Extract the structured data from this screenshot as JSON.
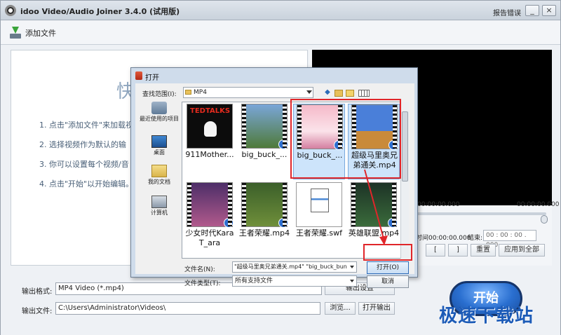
{
  "window": {
    "title": "idoo Video/Audio Joiner 3.4.0 (试用版)",
    "report_link": "报告错误",
    "minimize_glyph": "_",
    "close_glyph": "×"
  },
  "toolbar": {
    "add_label": "添加文件"
  },
  "hint": {
    "big_char": "快",
    "lines": [
      "1. 点击\"添加文件\"来加载视",
      "2. 选择视频作为默认的输",
      "3. 你可以设置每个视频/音",
      "4. 点击\"开始\"以开始编辑。"
    ]
  },
  "preview": {
    "time_left": "00:00:00.000",
    "time_right": "00:00:00.000",
    "start_time_label": "时间00:00:00.000",
    "end_label": "结束:",
    "end_time": "00 : 00 : 00 . 000",
    "mark_in": "[",
    "mark_out": "]",
    "reset": "重置",
    "apply_all": "应用到全部"
  },
  "bottom": {
    "format_label": "输出格式:",
    "format_value": "MP4 Video (*.mp4)",
    "settings_label": "输出设置",
    "file_label": "输出文件:",
    "path_value": "C:\\Users\\Administrator\\Videos\\",
    "browse": "浏览...",
    "open_output": "打开输出",
    "start": "开始"
  },
  "watermark": "极速下载站",
  "dialog": {
    "title": "打开",
    "lookin_label": "查找范围(I):",
    "lookin_value": "MP4",
    "back_glyph": "◆",
    "places": [
      "最近使用的项目",
      "桌面",
      "我的文档",
      "计算机"
    ],
    "files": [
      {
        "name": "911Mother...",
        "thumb_text": "TEDTALKS"
      },
      {
        "name": "big_buck_..."
      },
      {
        "name": "big_buck_..."
      },
      {
        "name": "超级马里奥兄弟通关.mp4"
      },
      {
        "name": "少女时代KaraT_ara"
      },
      {
        "name": "王者荣耀.mp4"
      },
      {
        "name": "王者荣耀.swf"
      },
      {
        "name": "英雄联盟.mp4"
      }
    ],
    "filename_label": "文件名(N):",
    "filename_value": "\"超级马里奥兄弟通关.mp4\" \"big_buck_bun",
    "filetype_label": "文件类型(T):",
    "filetype_value": "所有支持文件",
    "open_btn": "打开(O)",
    "cancel_btn": "取消"
  },
  "colors": {
    "annotation": "#e0262a",
    "accent": "#2a6fd0"
  }
}
